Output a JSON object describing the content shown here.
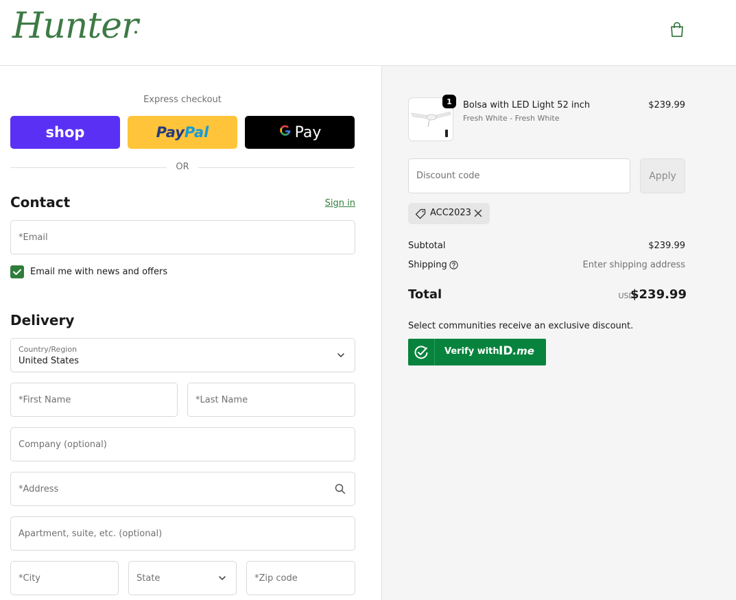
{
  "header": {
    "logo_text": "Hunter",
    "cart_icon": "shopping-bag-icon"
  },
  "express": {
    "title": "Express checkout",
    "shop_label": "shop",
    "paypal_part1": "Pay",
    "paypal_part2": "Pal",
    "gpay_g": "G",
    "gpay_label": "Pay",
    "or_text": "OR"
  },
  "contact": {
    "title": "Contact",
    "signin_label": "Sign in",
    "email_placeholder": "*Email",
    "newsletter_label": "Email me with news and offers",
    "newsletter_checked": true
  },
  "delivery": {
    "title": "Delivery",
    "country_label": "Country/Region",
    "country_value": "United States",
    "first_name_placeholder": "*First Name",
    "last_name_placeholder": "*Last Name",
    "company_placeholder": "Company (optional)",
    "address_placeholder": "*Address",
    "apartment_placeholder": "Apartment, suite, etc. (optional)",
    "city_placeholder": "*City",
    "state_placeholder": "State",
    "zip_placeholder": "*Zip code"
  },
  "order": {
    "quantity": "1",
    "product_name": "Bolsa with LED Light 52 inch",
    "product_variant": "Fresh White - Fresh White",
    "product_price": "$239.99",
    "discount_placeholder": "Discount code",
    "apply_label": "Apply",
    "applied_code": "ACC2023",
    "subtotal_label": "Subtotal",
    "subtotal_value": "$239.99",
    "shipping_label": "Shipping",
    "shipping_value": "Enter shipping address",
    "total_label": "Total",
    "currency": "USD",
    "total_value": "$239.99",
    "communities_text": "Select communities receive an exclusive discount.",
    "verify_label": "Verify with",
    "idme_main": "ID",
    "idme_suffix": ".me"
  },
  "colors": {
    "brand_green": "#3d7a45",
    "shop_purple": "#5a31f4",
    "paypal_yellow": "#ffc439",
    "idme_green": "#08833d"
  }
}
